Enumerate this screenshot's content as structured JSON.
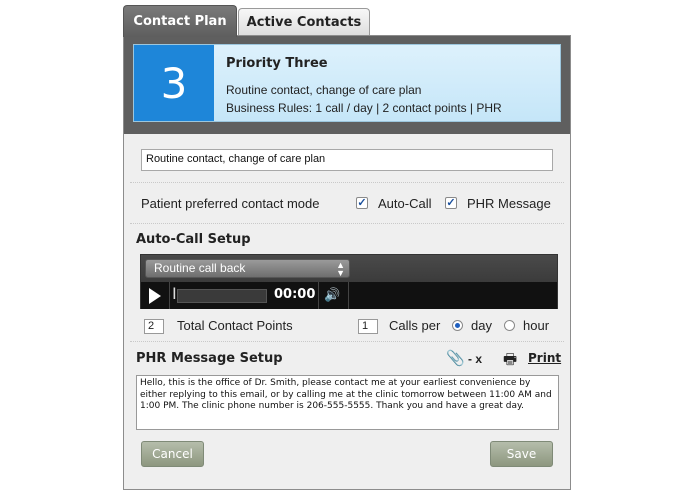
{
  "tabs": {
    "contact_plan": "Contact Plan",
    "active_contacts": "Active Contacts"
  },
  "priority": {
    "number": "3",
    "title": "Priority Three",
    "description": "Routine contact, change of care plan",
    "rules": "Business Rules: 1 call / day | 2 contact points | PHR"
  },
  "plan_field": {
    "value": "Routine contact, change of care plan"
  },
  "contact_mode": {
    "label": "Patient preferred contact mode",
    "options": [
      {
        "label": "Auto-Call",
        "checked": true
      },
      {
        "label": "PHR Message",
        "checked": true
      }
    ]
  },
  "autocall": {
    "title": "Auto-Call Setup",
    "selected_message": "Routine call back",
    "time": "00:00",
    "total_contact_points": "2",
    "total_contact_points_label": "Total Contact Points",
    "calls_per_value": "1",
    "calls_per_label": "Calls per",
    "period_options": [
      {
        "label": "day",
        "selected": true
      },
      {
        "label": "hour",
        "selected": false
      }
    ]
  },
  "phr": {
    "title": "PHR Message Setup",
    "attach_label": "- x",
    "print_label": "Print",
    "message": "Hello, this is the office of Dr. Smith, please contact me at your earliest convenience by either replying to this email, or by calling me at the clinic tomorrow between 11:00 AM and 1:00 PM. The clinic phone number is 206-555-5555. Thank you and have a great day."
  },
  "buttons": {
    "cancel": "Cancel",
    "save": "Save"
  }
}
